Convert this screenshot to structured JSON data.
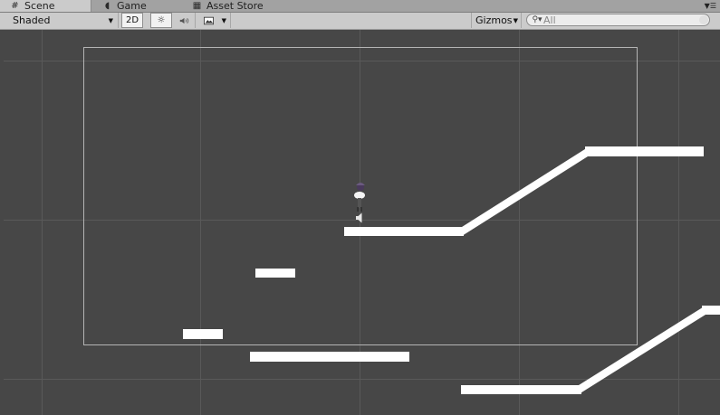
{
  "tabs": [
    {
      "label": "Scene",
      "icon": "grid-icon"
    },
    {
      "label": "Game",
      "icon": "game-icon"
    },
    {
      "label": "Asset Store",
      "icon": "store-icon"
    }
  ],
  "toolbar": {
    "shading_mode": "Shaded",
    "mode_2d_label": "2D",
    "gizmos_label": "Gizmos"
  },
  "search": {
    "placeholder": "All"
  },
  "colors": {
    "scene_background": "#474747",
    "grid_line": "#595959",
    "platform": "#ffffff",
    "camera_frame": "#b4b4b4",
    "toolbar": "#cbcbcb",
    "tab_bar": "#a2a2a2"
  }
}
